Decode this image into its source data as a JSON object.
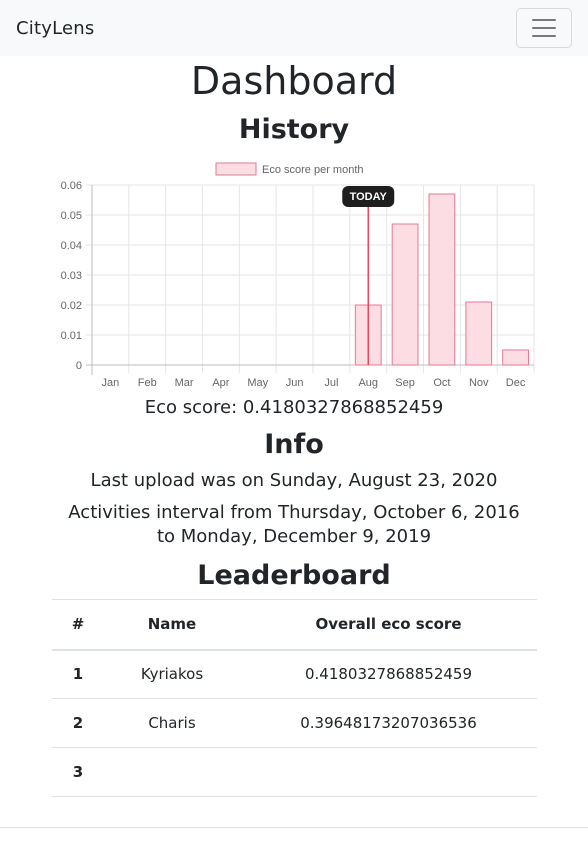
{
  "navbar": {
    "brand": "CityLens",
    "menu_icon": "hamburger-icon"
  },
  "page": {
    "title": "Dashboard",
    "history_heading": "History",
    "eco_score_text": "Eco score: 0.4180327868852459",
    "info_heading": "Info",
    "last_upload_text": "Last upload was on Sunday, August 23, 2020",
    "interval_text": "Activities interval from Thursday, October 6, 2016 to Monday, December 9, 2019",
    "leaderboard_heading": "Leaderboard"
  },
  "chart_data": {
    "type": "bar",
    "categories": [
      "Jan",
      "Feb",
      "Mar",
      "Apr",
      "May",
      "Jun",
      "Jul",
      "Aug",
      "Sep",
      "Oct",
      "Nov",
      "Dec"
    ],
    "series": [
      {
        "name": "Eco score per month",
        "values": [
          0,
          0,
          0,
          0,
          0,
          0,
          0,
          0.02,
          0.047,
          0.057,
          0.021,
          0.005
        ]
      }
    ],
    "ylim": [
      0,
      0.06
    ],
    "yticks": [
      "0.06",
      "0.05",
      "0.04",
      "0.03",
      "0.02",
      "0.01",
      "0"
    ],
    "grid": true,
    "legend": "top",
    "annotation": {
      "label": "TODAY",
      "category": "Aug"
    },
    "colors": {
      "bar_fill": "#fcdde4",
      "bar_stroke": "#e27a92",
      "today_line": "#e24b5f",
      "grid": "#e6e6e6"
    }
  },
  "leaderboard": {
    "headers": [
      "#",
      "Name",
      "Overall eco score"
    ],
    "rows": [
      {
        "rank": "1",
        "name": "Kyriakos",
        "score": "0.4180327868852459"
      },
      {
        "rank": "2",
        "name": "Charis",
        "score": "0.39648173207036536"
      },
      {
        "rank": "3",
        "name": "",
        "score": ""
      }
    ]
  }
}
